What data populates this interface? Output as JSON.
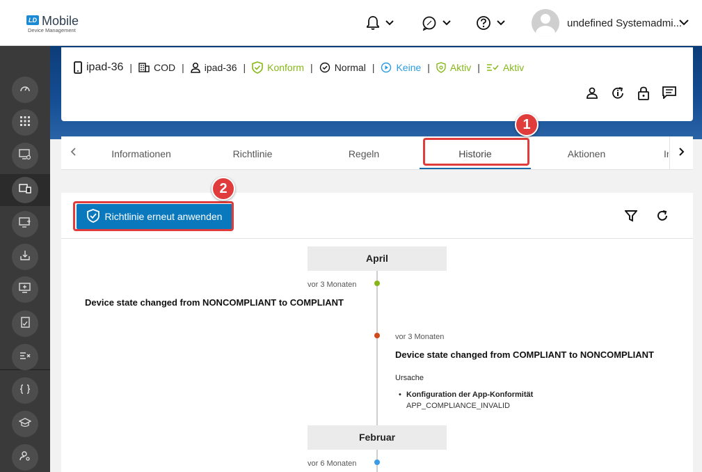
{
  "header": {
    "logo_badge": "LD",
    "logo_main": "Mobile",
    "logo_sub": "Device Management",
    "user_name": "undefined Systemadmi..."
  },
  "device": {
    "name": "ipad-36",
    "ownership": "COD",
    "user": "ipad-36",
    "compliance": "Konform",
    "mode": "Normal",
    "app_state": "Keine",
    "protection": "Aktiv",
    "rules": "Aktiv"
  },
  "tabs": [
    {
      "label": "Informationen"
    },
    {
      "label": "Richtlinie"
    },
    {
      "label": "Regeln"
    },
    {
      "label": "Historie"
    },
    {
      "label": "Aktionen"
    },
    {
      "label": "In"
    }
  ],
  "toolbar": {
    "reapply_label": "Richtlinie erneut anwenden"
  },
  "timeline": {
    "months": [
      "April",
      "Februar"
    ],
    "events": [
      {
        "time": "vor 3 Monaten",
        "text": "Device state changed from NONCOMPLIANT to COMPLIANT",
        "color": "#8ab51a"
      },
      {
        "time": "vor 3 Monaten",
        "text": "Device state changed from COMPLIANT to NONCOMPLIANT",
        "color": "#cf4a1c",
        "cause_label": "Ursache",
        "cause_title": "Konfiguration der App-Konformität",
        "cause_code": "APP_COMPLIANCE_INVALID"
      },
      {
        "time": "vor 6 Monaten",
        "color": "#3a9be6"
      }
    ]
  },
  "annotations": [
    "1",
    "2"
  ],
  "colors": {
    "accent": "#0a78bd",
    "green": "#86b817",
    "info_blue": "#2b9be0",
    "callout": "#e03c3c"
  }
}
